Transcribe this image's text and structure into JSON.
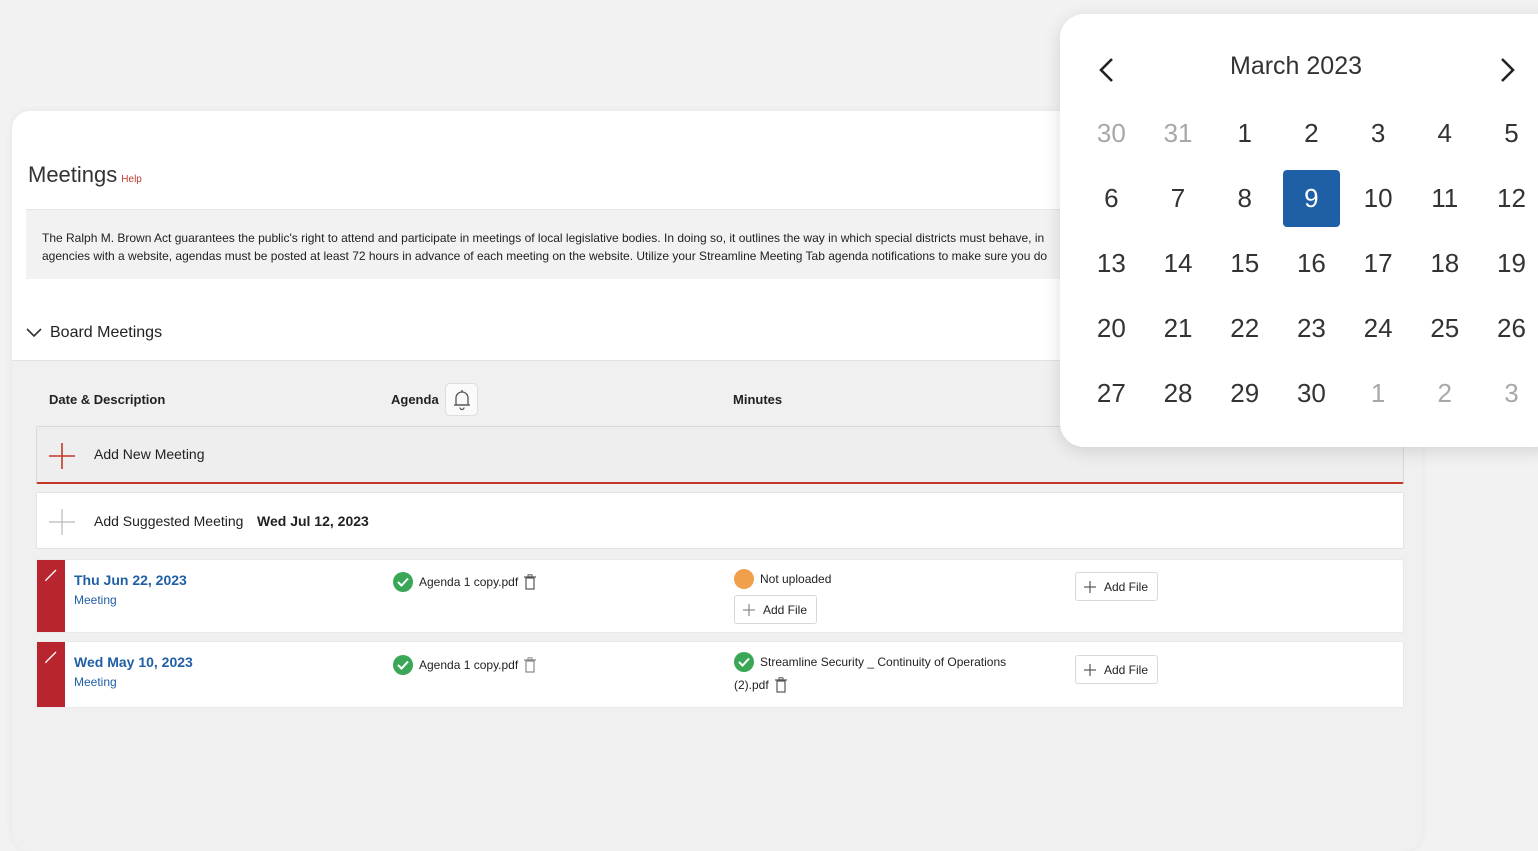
{
  "page": {
    "title": "Meetings",
    "help": "Help"
  },
  "description": {
    "line1": "The Ralph M. Brown Act guarantees the public's right to attend and participate in meetings of local legislative bodies. In doing so, it outlines the way in which special districts must behave, in",
    "line2": "agencies with a website, agendas must be posted at least 72 hours in advance of each meeting on the website. Utilize your Streamline Meeting Tab agenda notifications to make sure you do"
  },
  "section": {
    "label": "Board Meetings"
  },
  "table": {
    "col_date": "Date & Description",
    "col_agenda": "Agenda",
    "col_minutes": "Minutes"
  },
  "add_new": {
    "label": "Add New Meeting"
  },
  "suggested": {
    "label": "Add Suggested Meeting",
    "date": "Wed Jul 12, 2023"
  },
  "meetings": [
    {
      "date": "Thu Jun 22, 2023",
      "type": "Meeting",
      "agenda_file": "Agenda 1 copy.pdf",
      "minutes_status": "Not uploaded",
      "minutes_add": "Add File",
      "extra_add": "Add File"
    },
    {
      "date": "Wed May 10, 2023",
      "type": "Meeting",
      "agenda_file": "Agenda 1 copy.pdf",
      "minutes_file_line1": "Streamline Security _ Continuity of Operations",
      "minutes_file_line2": "(2).pdf",
      "extra_add": "Add File"
    }
  ],
  "calendar": {
    "month": "March 2023",
    "selected": "9",
    "weeks": [
      [
        "30",
        "31",
        "1",
        "2",
        "3",
        "4",
        "5"
      ],
      [
        "6",
        "7",
        "8",
        "9",
        "10",
        "11",
        "12"
      ],
      [
        "13",
        "14",
        "15",
        "16",
        "17",
        "18",
        "19"
      ],
      [
        "20",
        "21",
        "22",
        "23",
        "24",
        "25",
        "26"
      ],
      [
        "27",
        "28",
        "29",
        "30",
        "1",
        "2",
        "3"
      ]
    ],
    "muted_first_row": 2,
    "muted_last_row": 3
  },
  "colors": {
    "accent": "#b8252f",
    "link": "#1f5fa6",
    "success": "#3aa757",
    "warning": "#f0a04b"
  }
}
